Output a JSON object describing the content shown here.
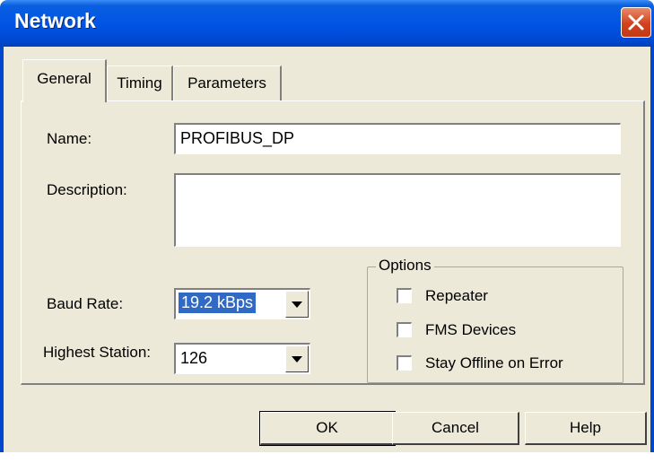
{
  "window": {
    "title": "Network"
  },
  "tabs": [
    "General",
    "Timing",
    "Parameters"
  ],
  "general": {
    "name_label": "Name:",
    "name_value": "PROFIBUS_DP",
    "description_label": "Description:",
    "description_value": "",
    "baud_label": "Baud Rate:",
    "baud_value": "19.2 kBps",
    "station_label": "Highest Station:",
    "station_value": "126"
  },
  "options": {
    "title": "Options",
    "items": [
      {
        "label": "Repeater",
        "checked": false
      },
      {
        "label": "FMS Devices",
        "checked": false
      },
      {
        "label": "Stay Offline on Error",
        "checked": false
      }
    ]
  },
  "buttons": {
    "ok": "OK",
    "cancel": "Cancel",
    "help": "Help"
  }
}
